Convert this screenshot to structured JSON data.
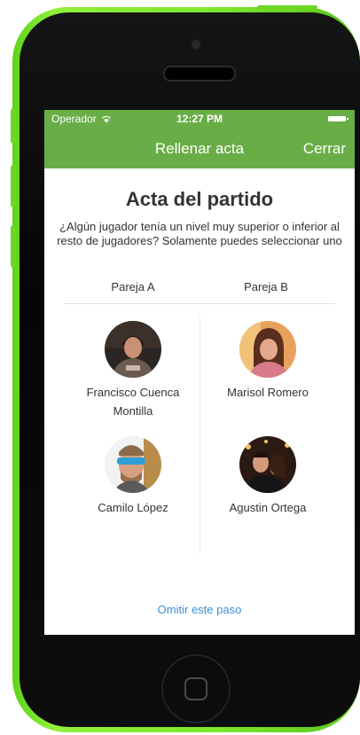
{
  "status_bar": {
    "carrier": "Operador",
    "time": "12:27 PM"
  },
  "navbar": {
    "title": "Rellenar acta",
    "close_label": "Cerrar"
  },
  "content": {
    "title": "Acta del partido",
    "question": "¿Algún jugador tenía un nivel muy superior o inferior al resto de jugadores? Solamente puedes seleccionar uno",
    "team_a_label": "Pareja A",
    "team_b_label": "Pareja B",
    "team_a_players": [
      {
        "name_line1": "Francisco Cuenca",
        "name_line2": "Montilla"
      },
      {
        "name_line1": "Camilo López",
        "name_line2": ""
      }
    ],
    "team_b_players": [
      {
        "name_line1": "Marisol Romero",
        "name_line2": ""
      },
      {
        "name_line1": "Agustin Ortega",
        "name_line2": ""
      }
    ],
    "skip_label": "Omitir este paso"
  },
  "colors": {
    "navbar": "#69ad47",
    "device": "#7ee52d",
    "link": "#3f8ed8"
  }
}
